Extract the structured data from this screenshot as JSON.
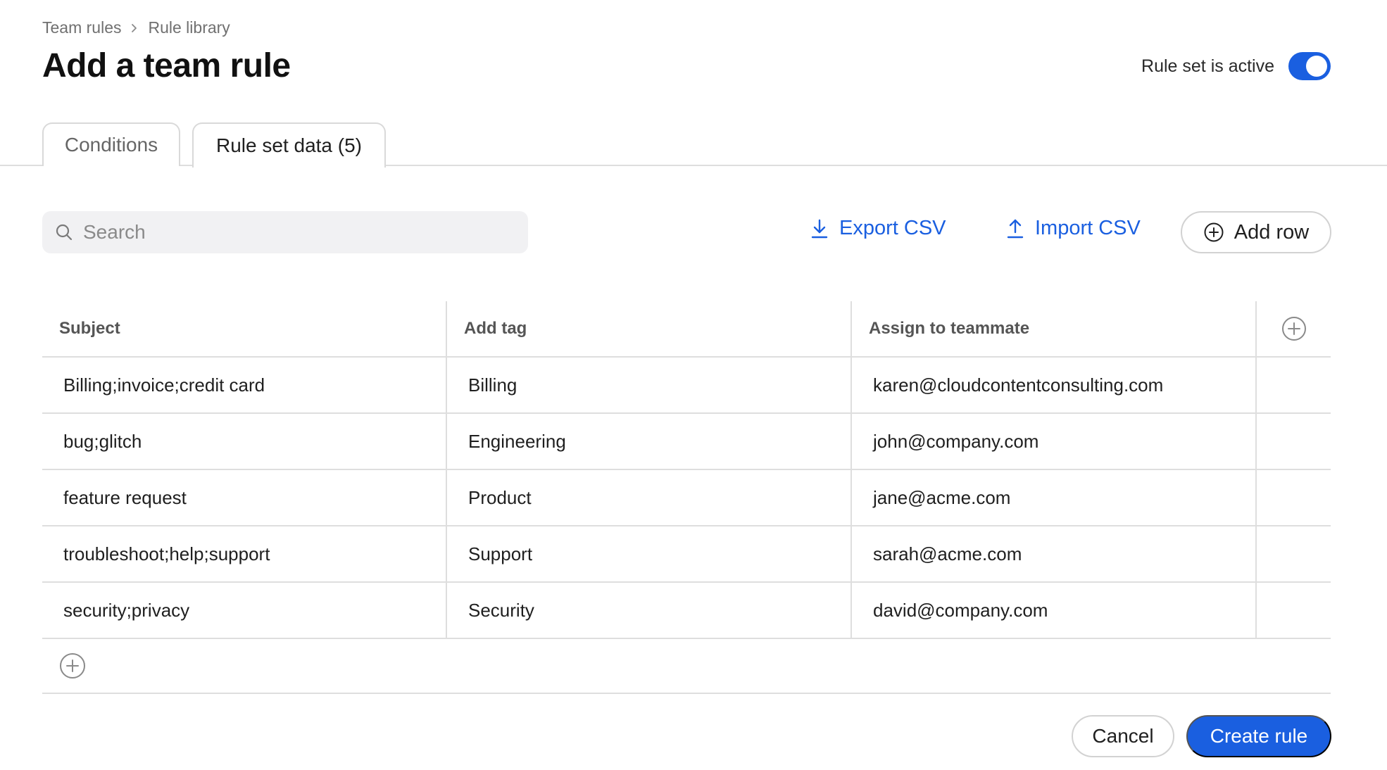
{
  "breadcrumb": {
    "items": [
      "Team rules",
      "Rule library"
    ]
  },
  "page": {
    "title": "Add a team rule"
  },
  "ruleset_status": {
    "label": "Rule set is active",
    "active": true
  },
  "tabs": [
    {
      "label": "Conditions",
      "selected": false
    },
    {
      "label": "Rule set data (5)",
      "selected": true
    }
  ],
  "toolbar": {
    "search_placeholder": "Search",
    "export_label": "Export CSV",
    "import_label": "Import CSV",
    "add_row_label": "Add row"
  },
  "table": {
    "columns": [
      "Subject",
      "Add tag",
      "Assign to teammate"
    ],
    "rows": [
      [
        "Billing;invoice;credit card",
        "Billing",
        "karen@cloudcontentconsulting.com"
      ],
      [
        "bug;glitch",
        "Engineering",
        "john@company.com"
      ],
      [
        "feature request",
        "Product",
        "jane@acme.com"
      ],
      [
        "troubleshoot;help;support",
        "Support",
        "sarah@acme.com"
      ],
      [
        "security;privacy",
        "Security",
        "david@company.com"
      ]
    ]
  },
  "footer": {
    "cancel_label": "Cancel",
    "create_label": "Create rule"
  },
  "colors": {
    "accent": "#1a5fe0",
    "border": "#dedede",
    "search_bg": "#f1f1f3"
  },
  "icons": [
    "chevron-right-icon",
    "search-icon",
    "download-icon",
    "upload-icon",
    "plus-circle-icon"
  ]
}
